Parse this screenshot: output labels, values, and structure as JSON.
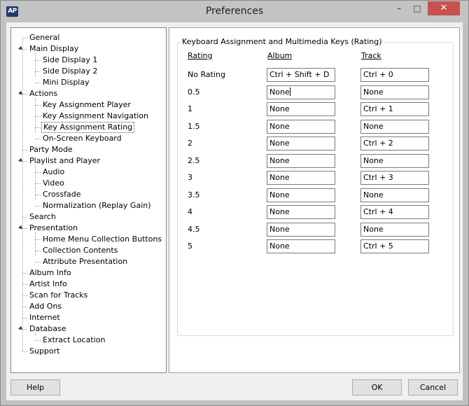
{
  "window": {
    "title": "Preferences",
    "logo": "AP",
    "minimize": "–",
    "maximize": "□",
    "close": "✕"
  },
  "tree": [
    {
      "label": "General",
      "level": 0
    },
    {
      "label": "Main Display",
      "level": 0,
      "expanded": true
    },
    {
      "label": "Side Display 1",
      "level": 1
    },
    {
      "label": "Side Display 2",
      "level": 1
    },
    {
      "label": "Mini Display",
      "level": 1
    },
    {
      "label": "Actions",
      "level": 0,
      "expanded": true
    },
    {
      "label": "Key Assignment Player",
      "level": 1
    },
    {
      "label": "Key Assignment Navigation",
      "level": 1
    },
    {
      "label": "Key Assignment Rating",
      "level": 1,
      "selected": true
    },
    {
      "label": "On-Screen Keyboard",
      "level": 1
    },
    {
      "label": "Party Mode",
      "level": 0
    },
    {
      "label": "Playlist and Player",
      "level": 0,
      "expanded": true
    },
    {
      "label": "Audio",
      "level": 1
    },
    {
      "label": "Video",
      "level": 1
    },
    {
      "label": "Crossfade",
      "level": 1
    },
    {
      "label": "Normalization (Replay Gain)",
      "level": 1
    },
    {
      "label": "Search",
      "level": 0
    },
    {
      "label": "Presentation",
      "level": 0,
      "expanded": true
    },
    {
      "label": "Home Menu Collection Buttons",
      "level": 1
    },
    {
      "label": "Collection Contents",
      "level": 1
    },
    {
      "label": "Attribute Presentation",
      "level": 1
    },
    {
      "label": "Album Info",
      "level": 0
    },
    {
      "label": "Artist Info",
      "level": 0
    },
    {
      "label": "Scan for Tracks",
      "level": 0
    },
    {
      "label": "Add Ons",
      "level": 0
    },
    {
      "label": "Internet",
      "level": 0
    },
    {
      "label": "Database",
      "level": 0,
      "expanded": true
    },
    {
      "label": "Extract Location",
      "level": 1
    },
    {
      "label": "Support",
      "level": 0
    }
  ],
  "panel": {
    "group_title": "Keyboard Assignment and Multimedia Keys (Rating)",
    "headers": {
      "rating": "Rating",
      "album": "Album",
      "track": "Track"
    },
    "rows": [
      {
        "rating": "No Rating",
        "album": "Ctrl + Shift + D",
        "track": "Ctrl + 0"
      },
      {
        "rating": "0.5",
        "album": "None",
        "track": "None",
        "focused": true
      },
      {
        "rating": "1",
        "album": "None",
        "track": "Ctrl + 1"
      },
      {
        "rating": "1.5",
        "album": "None",
        "track": "None"
      },
      {
        "rating": "2",
        "album": "None",
        "track": "Ctrl + 2"
      },
      {
        "rating": "2.5",
        "album": "None",
        "track": "None"
      },
      {
        "rating": "3",
        "album": "None",
        "track": "Ctrl + 3"
      },
      {
        "rating": "3.5",
        "album": "None",
        "track": "None"
      },
      {
        "rating": "4",
        "album": "None",
        "track": "Ctrl + 4"
      },
      {
        "rating": "4.5",
        "album": "None",
        "track": "None"
      },
      {
        "rating": "5",
        "album": "None",
        "track": "Ctrl + 5"
      }
    ]
  },
  "buttons": {
    "help": "Help",
    "ok": "OK",
    "cancel": "Cancel"
  }
}
